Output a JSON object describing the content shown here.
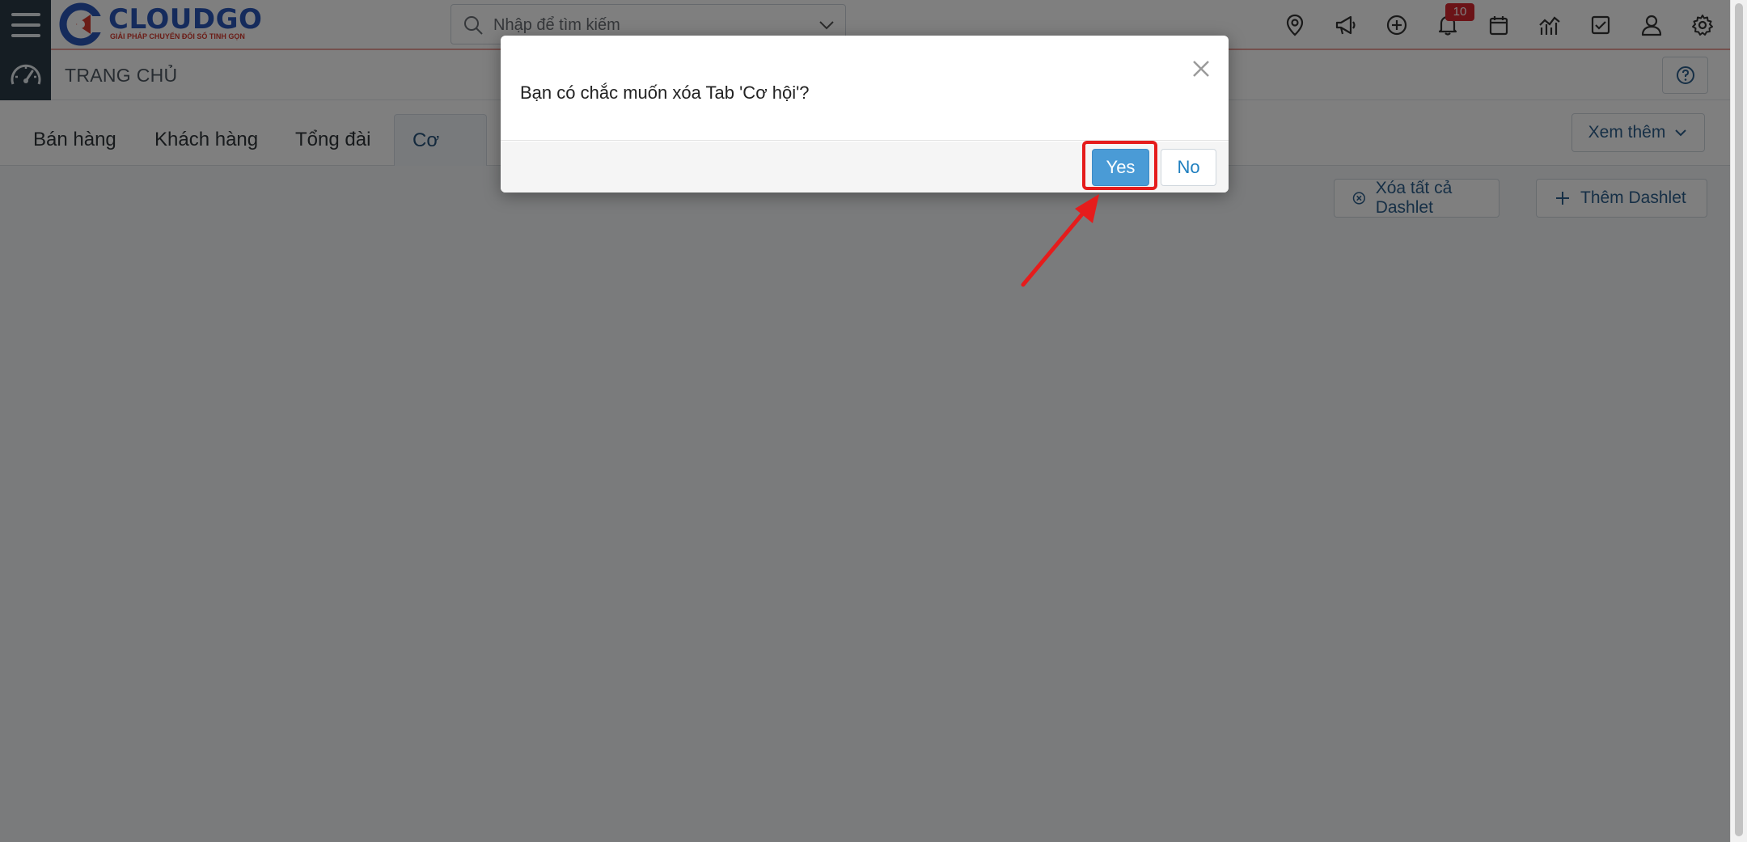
{
  "topbar": {
    "logo_name": "CLOUDGO",
    "logo_tagline": "GIẢI PHÁP CHUYỂN ĐỔI SỐ TINH GỌN",
    "search_placeholder": "Nhập để tìm kiếm",
    "notification_count": "10",
    "icons": [
      "location-icon",
      "megaphone-icon",
      "add-circle-icon",
      "bell-icon",
      "calendar-icon",
      "chart-icon",
      "task-check-icon",
      "user-icon",
      "gear-icon"
    ]
  },
  "breadcrumb": {
    "title": "TRANG CHỦ"
  },
  "tabs": {
    "items": [
      {
        "label": "Bán hàng"
      },
      {
        "label": "Khách hàng"
      },
      {
        "label": "Tổng đài"
      },
      {
        "label": "Cơ hội"
      }
    ],
    "active": "Cơ hội",
    "more_label": "Xem thêm"
  },
  "actions": {
    "clear_all_label": "Xóa tất cả Dashlet",
    "add_label": "Thêm Dashlet"
  },
  "modal": {
    "message": "Bạn có chắc muốn xóa Tab 'Cơ hội'?",
    "yes_label": "Yes",
    "no_label": "No"
  },
  "colors": {
    "brand_blue": "#2a56b8",
    "brand_red": "#d63a2f",
    "primary_button": "#4a9bd6",
    "link": "#2c5f8c",
    "annotation_red": "#e51c1c",
    "sidebar_dark": "#2b3a47"
  }
}
